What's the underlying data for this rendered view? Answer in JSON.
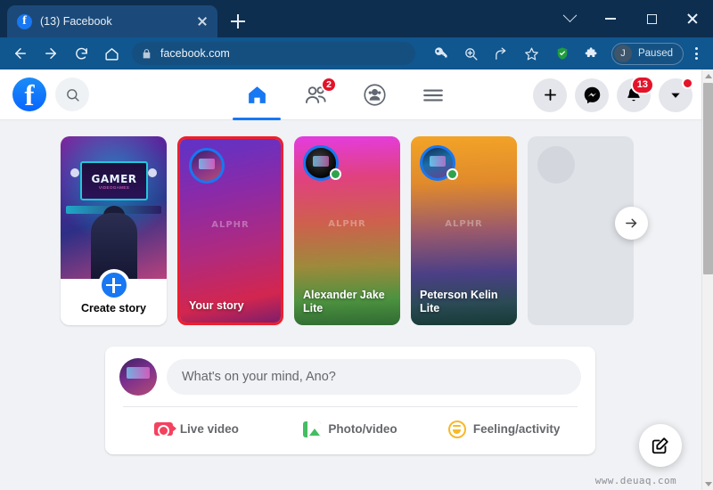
{
  "browser": {
    "tab": {
      "title": "(13) Facebook",
      "favicon": "f",
      "close_icon": "close-icon"
    },
    "new_tab_label": "+",
    "window_controls": [
      "chevron-down-icon",
      "minimize-icon",
      "maximize-icon",
      "close-icon"
    ],
    "nav": {
      "back": "back-arrow-icon",
      "forward": "forward-arrow-icon",
      "reload": "reload-icon",
      "home": "home-icon"
    },
    "omnibox": {
      "url": "facebook.com",
      "lock_icon": "lock-icon"
    },
    "toolbar_icons": [
      "key-icon",
      "zoom-search-icon",
      "share-icon",
      "star-icon",
      "shield-icon",
      "extensions-puzzle-icon"
    ],
    "profile": {
      "initial": "J",
      "label": "Paused"
    },
    "menu_icon": "kebab-menu-icon",
    "colors": {
      "tabstrip": "#0e2e4f",
      "toolbar": "#10568f",
      "tab_active": "#1b4a7a"
    }
  },
  "facebook": {
    "logo": "f",
    "search_icon": "search-icon",
    "nav_tabs": [
      {
        "name": "home",
        "icon": "home-icon",
        "active": true,
        "badge": ""
      },
      {
        "name": "friends",
        "icon": "friends-icon",
        "active": false,
        "badge": "2"
      },
      {
        "name": "groups",
        "icon": "groups-icon",
        "active": false,
        "badge": ""
      },
      {
        "name": "menu",
        "icon": "hamburger-menu-icon",
        "active": false,
        "badge": ""
      }
    ],
    "right_actions": [
      {
        "name": "create",
        "icon": "plus-icon",
        "badge": ""
      },
      {
        "name": "messenger",
        "icon": "messenger-icon",
        "badge": ""
      },
      {
        "name": "notifications",
        "icon": "bell-icon",
        "badge": "13"
      },
      {
        "name": "account",
        "icon": "chevron-down-icon",
        "badge": "dot"
      }
    ],
    "colors": {
      "accent": "#1877f2",
      "badge": "#e4132a",
      "bg": "#f0f2f5",
      "online": "#31a24c",
      "selected_border": "#f01e2c"
    }
  },
  "stories": {
    "create": {
      "label": "Create story",
      "thumb_text": "GAMER",
      "thumb_sub": "VIDEOGAMES",
      "plus_icon": "plus-icon"
    },
    "items": [
      {
        "name": "Your story",
        "watermark": "ALPHR",
        "selected": true,
        "online": false
      },
      {
        "name": "Alexander Jake Lite",
        "watermark": "ALPHR",
        "selected": false,
        "online": true
      },
      {
        "name": "Peterson Kelin Lite",
        "watermark": "ALPHR",
        "selected": false,
        "online": true
      },
      {
        "name": "",
        "watermark": "",
        "selected": false,
        "online": false,
        "skeleton": true
      }
    ],
    "next_icon": "arrow-right-icon"
  },
  "composer": {
    "placeholder": "What's on your mind, Ano?",
    "actions": [
      {
        "label": "Live video",
        "icon": "live-video-icon"
      },
      {
        "label": "Photo/video",
        "icon": "photo-video-icon"
      },
      {
        "label": "Feeling/activity",
        "icon": "feeling-activity-icon"
      }
    ]
  },
  "fab": {
    "icon": "compose-edit-icon"
  },
  "watermark": "www.deuaq.com",
  "scrollbar": {
    "up_icon": "scroll-up-arrow-icon",
    "down_icon": "scroll-down-arrow-icon"
  }
}
